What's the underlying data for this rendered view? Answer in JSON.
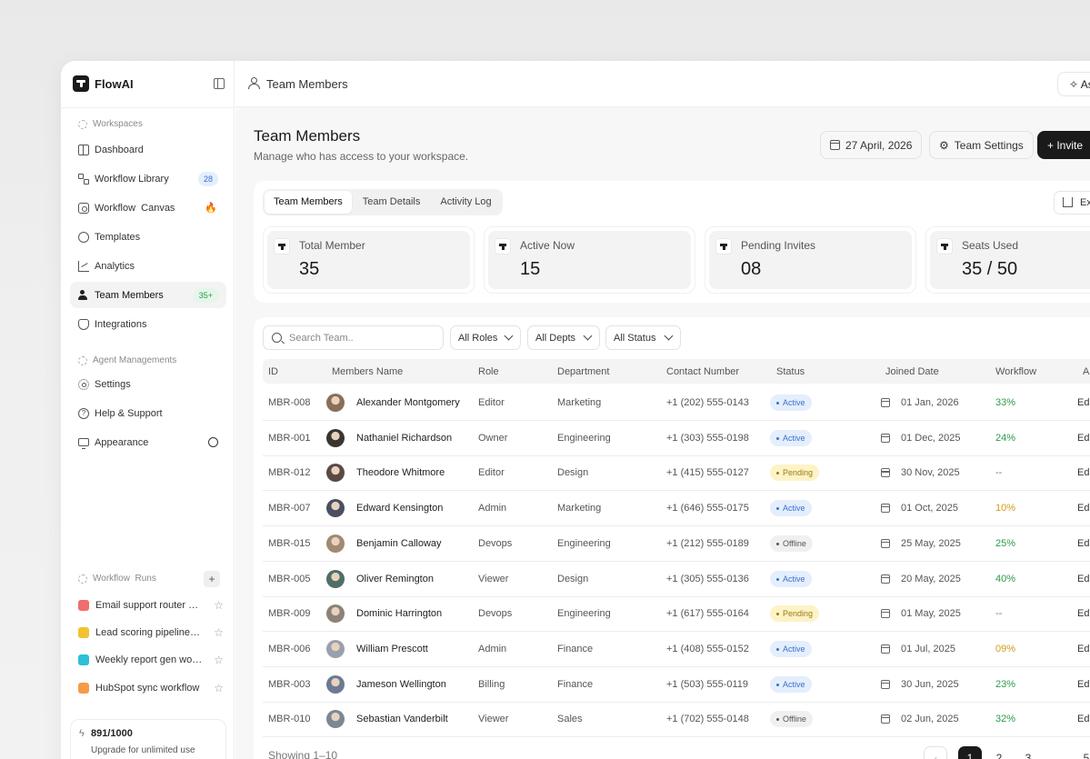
{
  "app": {
    "name": "FlowAI"
  },
  "sidebar": {
    "workspaces_title": "Workspaces",
    "items": [
      {
        "label": "Dashboard",
        "icon": "grid-icon"
      },
      {
        "label": "Workflow Library",
        "icon": "flow-icon",
        "badge": "28"
      },
      {
        "label": "Workflow  Canvas",
        "icon": "canvas-icon",
        "extra": "🔥"
      },
      {
        "label": "Templates",
        "icon": "templates-icon"
      },
      {
        "label": "Analytics",
        "icon": "analytics-icon"
      },
      {
        "label": "Team Members",
        "icon": "team-icon",
        "badge": "35+"
      },
      {
        "label": "Integrations",
        "icon": "shield-icon"
      }
    ],
    "agent_title": "Agent Managements",
    "agent_items": [
      {
        "label": "Settings",
        "icon": "gear-icon"
      },
      {
        "label": "Help & Support",
        "icon": "help-icon"
      },
      {
        "label": "Appearance",
        "icon": "monitor-icon"
      }
    ],
    "runs_title": "Workflow  Runs",
    "plus": "+",
    "runs": [
      {
        "label": "Email support router workflow",
        "color": "#f26d6d"
      },
      {
        "label": "Lead scoring pipeline Workflow",
        "color": "#f2c230"
      },
      {
        "label": "Weekly report gen workflow",
        "color": "#2bc0d8"
      },
      {
        "label": "HubSpot sync workflow",
        "color": "#f59b4b"
      }
    ],
    "usage": {
      "count": "891/1000",
      "text": "Upgrade for unlimited use"
    }
  },
  "topbar": {
    "title": "Team Members",
    "ask_label": "As"
  },
  "page": {
    "title": "Team Members",
    "subtitle": "Manage who has access to your workspace.",
    "date_label": "27 April, 2026",
    "settings_label": "Team Settings",
    "invite_label": "+ Invite"
  },
  "tabs": [
    "Team Members",
    "Team Details",
    "Activity Log"
  ],
  "export_label": "Ex",
  "stats": [
    {
      "label": "Total Member",
      "value": "35"
    },
    {
      "label": "Active Now",
      "value": "15"
    },
    {
      "label": "Pending Invites",
      "value": "08"
    },
    {
      "label": "Seats Used",
      "value": "35 / 50"
    }
  ],
  "filters": {
    "search_placeholder": "Search Team..",
    "roles": "All Roles",
    "depts": "All Depts",
    "status": "All Status"
  },
  "table": {
    "headers": [
      "ID",
      "Members Name",
      "Role",
      "Department",
      "Contact Number",
      "Status",
      "Joined Date",
      "Workflow",
      "A"
    ],
    "rows": [
      {
        "id": "MBR-008",
        "name": "Alexander Montgomery",
        "role": "Editor",
        "dept": "Marketing",
        "phone": "+1 (202) 555-0143",
        "status": "Active",
        "date": "01 Jan, 2026",
        "workflow": "33%",
        "action": "Edi",
        "wf_color": "#2e9a4b",
        "avatar": "#8a6e58"
      },
      {
        "id": "MBR-001",
        "name": "Nathaniel Richardson",
        "role": "Owner",
        "dept": "Engineering",
        "phone": "+1 (303) 555-0198",
        "status": "Active",
        "date": "01 Dec, 2025",
        "workflow": "24%",
        "action": "Edi",
        "wf_color": "#2e9a4b",
        "avatar": "#3b3530"
      },
      {
        "id": "MBR-012",
        "name": "Theodore Whitmore",
        "role": "Editor",
        "dept": "Design",
        "phone": "+1 (415) 555-0127",
        "status": "Pending",
        "date": "30 Nov, 2025",
        "workflow": "--",
        "action": "Edi",
        "wf_color": "#777777",
        "avatar": "#5a4a44"
      },
      {
        "id": "MBR-007",
        "name": "Edward Kensington",
        "role": "Admin",
        "dept": "Marketing",
        "phone": "+1 (646) 555-0175",
        "status": "Active",
        "date": "01 Oct, 2025",
        "workflow": "10%",
        "action": "Edi",
        "wf_color": "#d49a1b",
        "avatar": "#4a5060"
      },
      {
        "id": "MBR-015",
        "name": "Benjamin Calloway",
        "role": "Devops",
        "dept": "Engineering",
        "phone": "+1 (212) 555-0189",
        "status": "Offline",
        "date": "25 May, 2025",
        "workflow": "25%",
        "action": "Edi",
        "wf_color": "#2e9a4b",
        "avatar": "#a08a70"
      },
      {
        "id": "MBR-005",
        "name": "Oliver Remington",
        "role": "Viewer",
        "dept": "Design",
        "phone": "+1 (305) 555-0136",
        "status": "Active",
        "date": "20 May, 2025",
        "workflow": "40%",
        "action": "Edi",
        "wf_color": "#2e9a4b",
        "avatar": "#4f6e66"
      },
      {
        "id": "MBR-009",
        "name": "Dominic Harrington",
        "role": "Devops",
        "dept": "Engineering",
        "phone": "+1 (617) 555-0164",
        "status": "Pending",
        "date": "01 May, 2025",
        "workflow": "--",
        "action": "Edi",
        "wf_color": "#777777",
        "avatar": "#8c8278"
      },
      {
        "id": "MBR-006",
        "name": "William Prescott",
        "role": "Admin",
        "dept": "Finance",
        "phone": "+1 (408) 555-0152",
        "status": "Active",
        "date": "01 Jul, 2025",
        "workflow": "09%",
        "action": "Edi",
        "wf_color": "#d49a1b",
        "avatar": "#9aa0ac"
      },
      {
        "id": "MBR-003",
        "name": "Jameson Wellington",
        "role": "Billing",
        "dept": "Finance",
        "phone": "+1 (503) 555-0119",
        "status": "Active",
        "date": "30 Jun, 2025",
        "workflow": "23%",
        "action": "Edi",
        "wf_color": "#2e9a4b",
        "avatar": "#6c7a92"
      },
      {
        "id": "MBR-010",
        "name": "Sebastian Vanderbilt",
        "role": "Viewer",
        "dept": "Sales",
        "phone": "+1 (702) 555-0148",
        "status": "Offline",
        "date": "02 Jun, 2025",
        "workflow": "32%",
        "action": "Edi",
        "wf_color": "#2e9a4b",
        "avatar": "#7a8894"
      }
    ],
    "footer": "Showing 1–10",
    "pages": [
      "‹",
      "1",
      "2",
      "3",
      "…",
      "5"
    ]
  }
}
